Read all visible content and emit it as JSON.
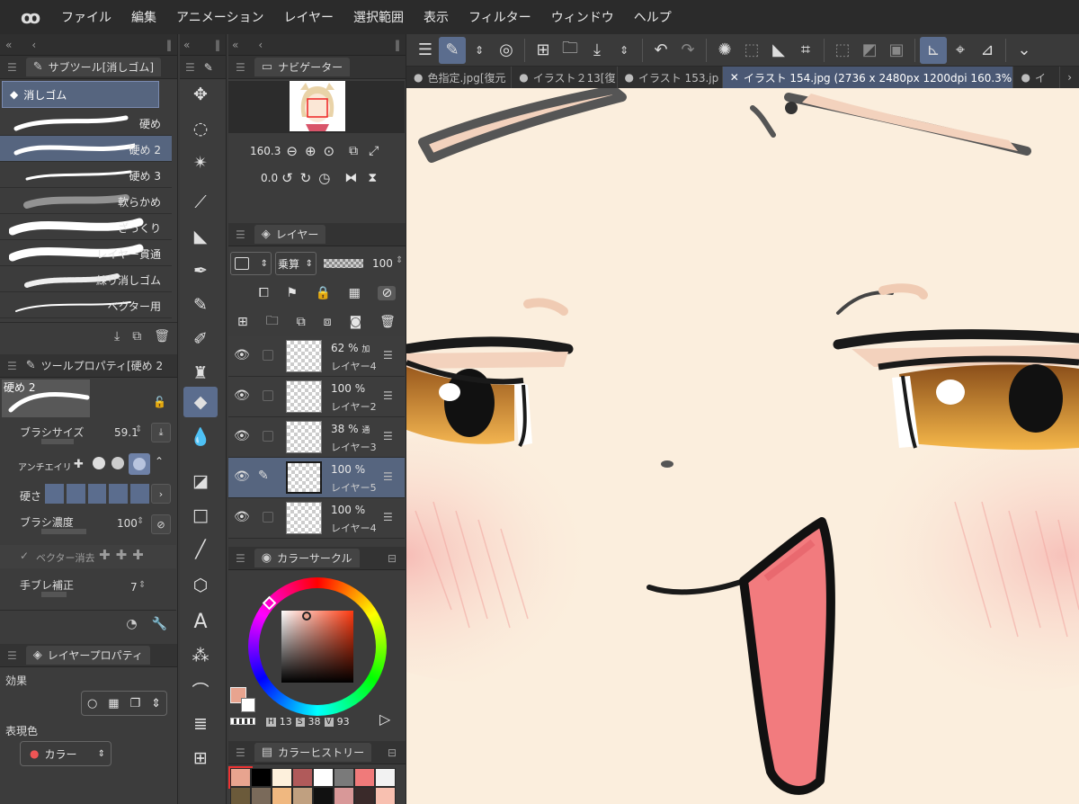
{
  "menubar": {
    "items": [
      "ファイル",
      "編集",
      "アニメーション",
      "レイヤー",
      "選択範囲",
      "表示",
      "フィルター",
      "ウィンドウ",
      "ヘルプ"
    ]
  },
  "tabs": [
    {
      "label": "色指定.jpg[復元"
    },
    {
      "label": "イラスト２13[復"
    },
    {
      "label": "イラスト 153.jp"
    },
    {
      "label": "イラスト 154.jpg (2736 x 2480px 1200dpi 160.3%)"
    },
    {
      "label": "イ"
    }
  ],
  "subtool": {
    "title": "サブツール[消しゴム]",
    "group": "消しゴム",
    "brushes": [
      {
        "label": "硬め"
      },
      {
        "label": "硬め 2"
      },
      {
        "label": "硬め 3"
      },
      {
        "label": "軟らかめ"
      },
      {
        "label": "ざっくり"
      },
      {
        "label": "レイヤー貫通"
      },
      {
        "label": "練り消しゴム"
      },
      {
        "label": "ベクター用"
      }
    ]
  },
  "toolprop": {
    "title": "ツールプロパティ[硬め 2",
    "preset": "硬め 2",
    "brush_size_label": "ブラシサイズ",
    "brush_size": "59.1",
    "antialias_label": "アンチエイリ",
    "hardness_label": "硬さ",
    "density_label": "ブラシ濃度",
    "density": "100",
    "vector_erase_label": "ベクター消去",
    "stabilization_label": "手ブレ補正",
    "stabilization": "7"
  },
  "layerprop": {
    "title": "レイヤープロパティ",
    "effect_label": "効果",
    "expression_label": "表現色",
    "expression_value": "カラー"
  },
  "navigator": {
    "title": "ナビゲーター",
    "zoom": "160.3",
    "rotation": "0.0"
  },
  "layers": {
    "title": "レイヤー",
    "blend_mode": "乗算",
    "opacity": "100",
    "rows": [
      {
        "opacity": "62 %",
        "mode": "加",
        "name": "レイヤー4",
        "selected": false
      },
      {
        "opacity": "100 %",
        "mode": "",
        "name": "レイヤー2",
        "selected": false
      },
      {
        "opacity": "38 %",
        "mode": "通",
        "name": "レイヤー3",
        "selected": false
      },
      {
        "opacity": "100 %",
        "mode": "",
        "name": "レイヤー5",
        "selected": true
      },
      {
        "opacity": "100 %",
        "mode": "",
        "name": "レイヤー4",
        "selected": false
      }
    ]
  },
  "colorcircle": {
    "title": "カラーサークル",
    "h_label": "H",
    "h": "13",
    "s_label": "S",
    "s": "38",
    "v_label": "V",
    "v": "93",
    "main_color": "#e8a48f"
  },
  "colorhistory": {
    "title": "カラーヒストリー",
    "swatches": [
      "#e8a48f",
      "#000000",
      "#fdf0dc",
      "#b05a5a",
      "#ffffff",
      "#7a7a7a",
      "#f07a7a",
      "#f2f2f2",
      "#6b5a3a",
      "#7a6a5a",
      "#f0b880",
      "#c0a080",
      "#111111",
      "#d89898",
      "#3a2a2a",
      "#f8c0b0",
      "#e8a090",
      "#f0c8b8",
      "#f8e8d8",
      "#e89090",
      "#f8d8c8",
      "#e8b8a8",
      "#fde0d0",
      "#f0a8a8"
    ],
    "indicator_colors": [
      "#d01010",
      "#10b010",
      "#1010d0"
    ]
  },
  "colors": {
    "accent": "#5b6d8e",
    "panel": "#3c3c3c",
    "canvas_bg": "#fbeedd",
    "tongue": "#f27b7e",
    "iris": "#d8923a"
  }
}
